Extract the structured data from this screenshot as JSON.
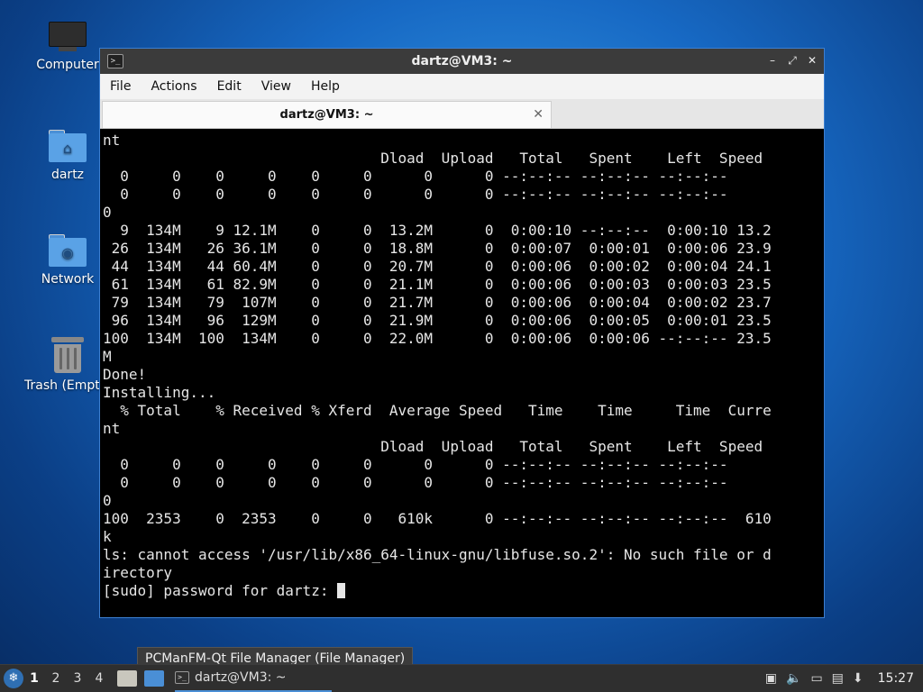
{
  "desktop": {
    "icons": [
      {
        "label": "Computer"
      },
      {
        "label": "dartz"
      },
      {
        "label": "Network"
      },
      {
        "label": "Trash (Empty)"
      }
    ]
  },
  "window": {
    "title": "dartz@VM3: ~",
    "menu": [
      "File",
      "Actions",
      "Edit",
      "View",
      "Help"
    ],
    "tab_label": "dartz@VM3: ~",
    "terminal_lines": [
      "nt",
      "                                Dload  Upload   Total   Spent    Left  Speed",
      "  0     0    0     0    0     0      0      0 --:--:-- --:--:-- --:--:--",
      "  0     0    0     0    0     0      0      0 --:--:-- --:--:-- --:--:--",
      "0",
      "  9  134M    9 12.1M    0     0  13.2M      0  0:00:10 --:--:--  0:00:10 13.2",
      " 26  134M   26 36.1M    0     0  18.8M      0  0:00:07  0:00:01  0:00:06 23.9",
      " 44  134M   44 60.4M    0     0  20.7M      0  0:00:06  0:00:02  0:00:04 24.1",
      " 61  134M   61 82.9M    0     0  21.1M      0  0:00:06  0:00:03  0:00:03 23.5",
      " 79  134M   79  107M    0     0  21.7M      0  0:00:06  0:00:04  0:00:02 23.7",
      " 96  134M   96  129M    0     0  21.9M      0  0:00:06  0:00:05  0:00:01 23.5",
      "100  134M  100  134M    0     0  22.0M      0  0:00:06  0:00:06 --:--:-- 23.5",
      "M",
      "Done!",
      "Installing...",
      "  % Total    % Received % Xferd  Average Speed   Time    Time     Time  Curre",
      "nt",
      "                                Dload  Upload   Total   Spent    Left  Speed",
      "  0     0    0     0    0     0      0      0 --:--:-- --:--:-- --:--:--",
      "  0     0    0     0    0     0      0      0 --:--:-- --:--:-- --:--:--",
      "0",
      "100  2353    0  2353    0     0   610k      0 --:--:-- --:--:-- --:--:--  610",
      "k",
      "ls: cannot access '/usr/lib/x86_64-linux-gnu/libfuse.so.2': No such file or d",
      "irectory"
    ],
    "prompt": "[sudo] password for dartz: "
  },
  "tooltip": "PCManFM-Qt File Manager (File Manager)",
  "taskbar": {
    "workspaces": [
      "1",
      "2",
      "3",
      "4"
    ],
    "task_label": "dartz@VM3: ~",
    "clock": "15:27"
  }
}
